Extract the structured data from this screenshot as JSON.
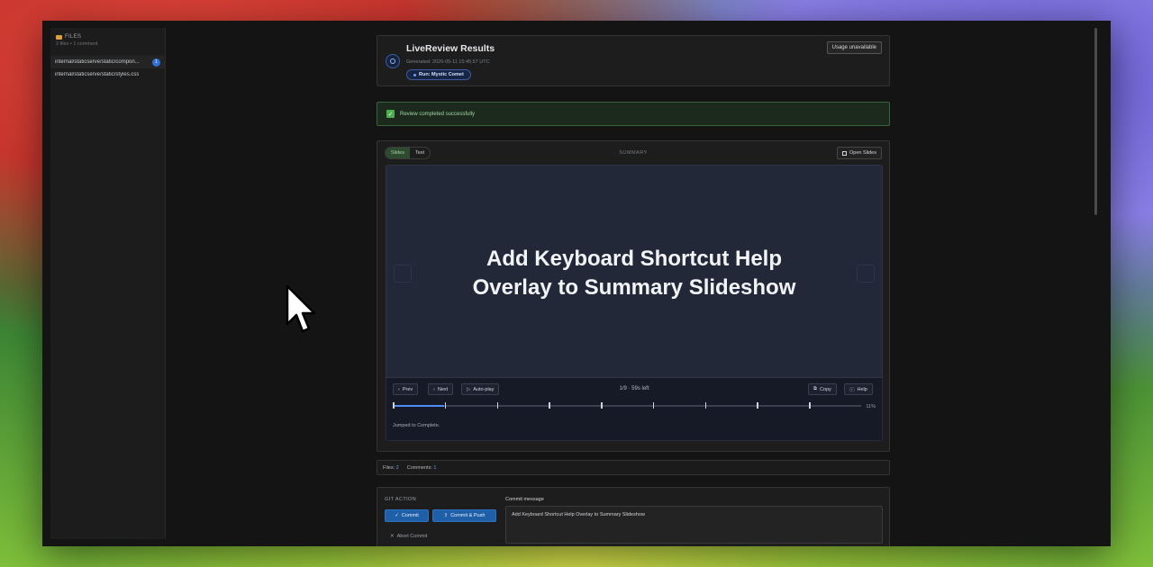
{
  "sidebar": {
    "header": "FILES",
    "subheader": "2 files • 1 comment",
    "files": [
      {
        "name": "internal/staticserve/static/compon...",
        "badge": "1"
      },
      {
        "name": "internal/staticserve/static/styles.css",
        "badge": ""
      }
    ]
  },
  "header": {
    "title": "LiveReview Results",
    "generated": "Generated: 2026-05-11 15:45:57 UTC",
    "run": "Run: Mystic Comet",
    "usage_button": "Usage unavailable"
  },
  "success": {
    "message": "Review completed successfully"
  },
  "summary": {
    "toggle": [
      "Slides",
      "Text"
    ],
    "label": "SUMMARY",
    "open_slides": "Open Slides",
    "slide_title_line1": "Add Keyboard Shortcut Help",
    "slide_title_line2": "Overlay to Summary Slideshow",
    "prev": "Prev",
    "next": "Next",
    "autoplay": "Auto-play",
    "counter": "1/9 · 59s left",
    "copy": "Copy",
    "help": "Help",
    "progress_percent": "11%",
    "progress_fraction": 0.11,
    "status": "Jumped to Complete."
  },
  "stats": {
    "files_label": "Files:",
    "files_value": "2",
    "comments_label": "Comments:",
    "comments_value": "1"
  },
  "git": {
    "label": "GIT ACTION",
    "commit": "Commit",
    "commit_push": "Commit & Push",
    "abort": "Abort Commit",
    "commit_message_label": "Commit message",
    "commit_message": "Add Keyboard Shortcut Help Overlay to Summary Slideshow"
  },
  "colors": {
    "accent": "#2f6fd6",
    "success": "#4caf50"
  }
}
